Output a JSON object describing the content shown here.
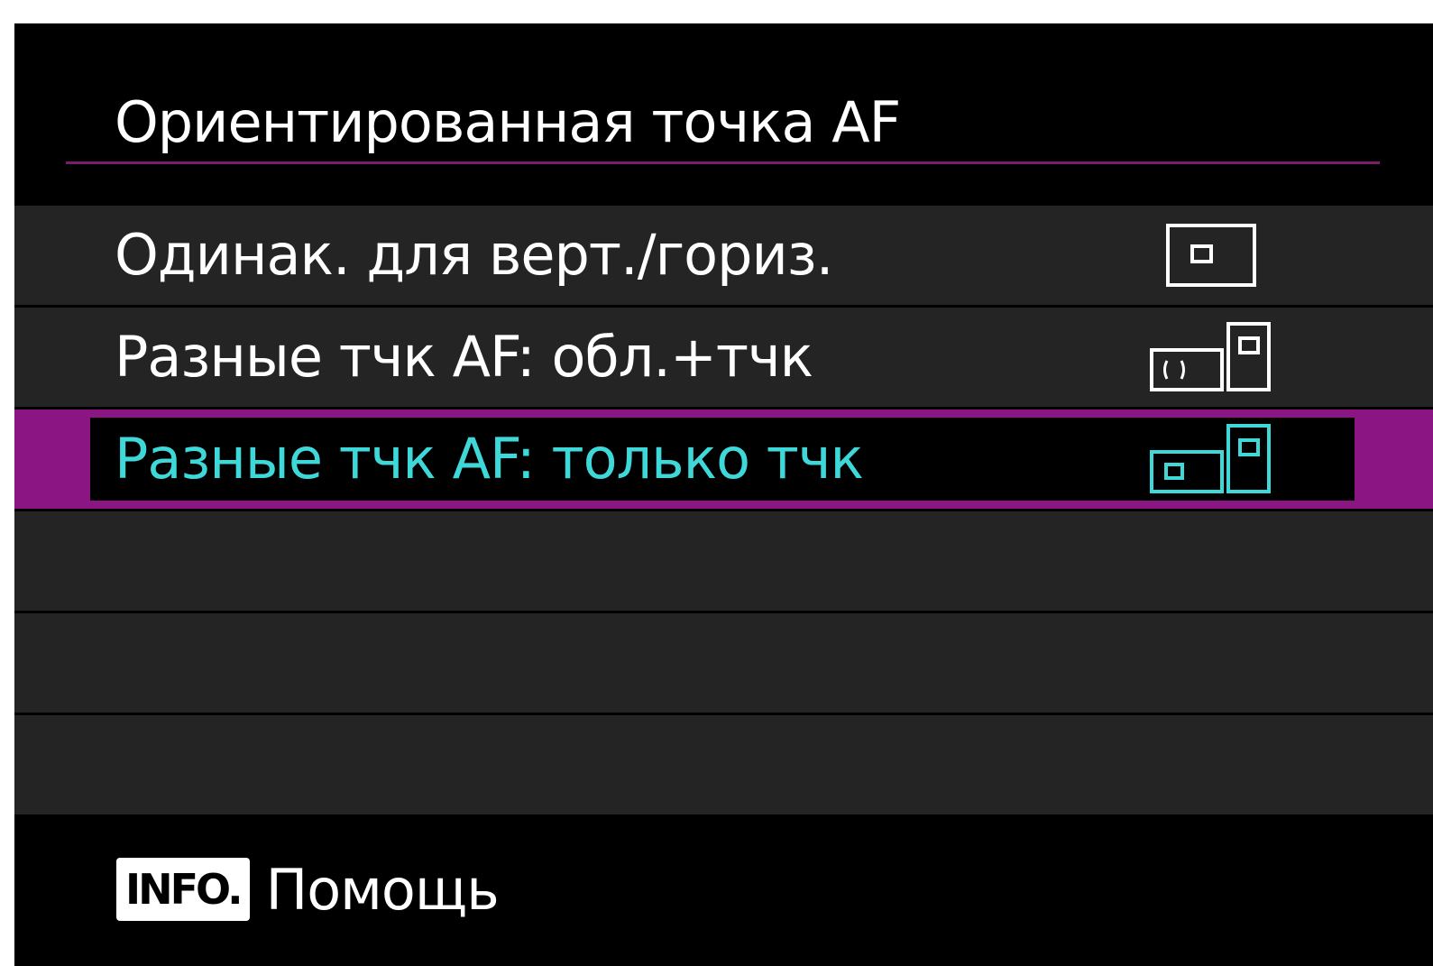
{
  "menu": {
    "title": "Ориентированная точка AF",
    "items": [
      {
        "label": "Одинак. для верт./гориз.",
        "icon": "af-point-same-icon",
        "selected": false
      },
      {
        "label": "Разные тчк AF: обл.+тчк",
        "icon": "af-area-point-separate-icon",
        "selected": false
      },
      {
        "label": "Разные тчк AF: только тчк",
        "icon": "af-point-only-separate-icon",
        "selected": true
      }
    ]
  },
  "footer": {
    "info_button": "INFO.",
    "help_label": "Помощь"
  },
  "colors": {
    "background": "#000000",
    "row": "#242424",
    "accent": "#8b1582",
    "selected_text": "#3fd8d8",
    "text": "#ffffff"
  }
}
